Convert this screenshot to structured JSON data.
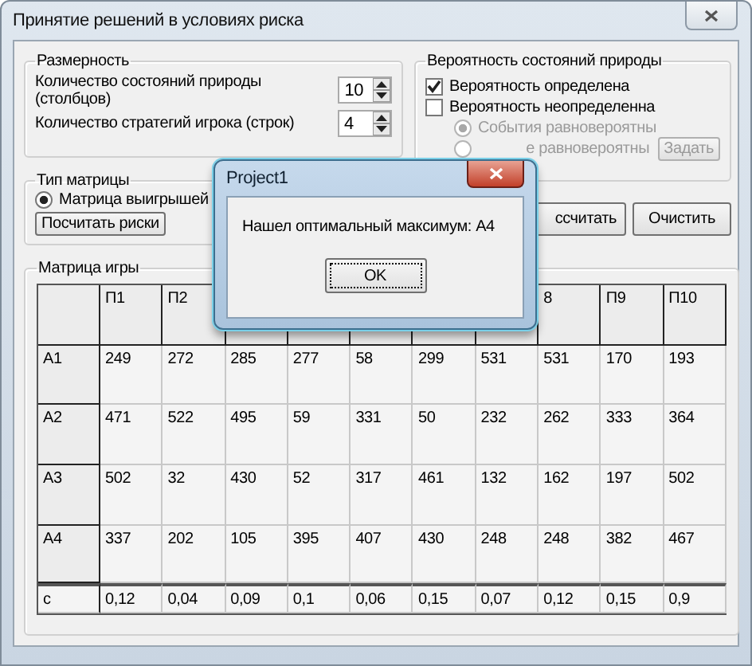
{
  "window": {
    "title": "Принятие решений в условиях риска"
  },
  "dimension_group": {
    "title": "Размерность",
    "fields": [
      {
        "label": "Количество состояний природы (столбцов)",
        "value": "10"
      },
      {
        "label": "Количество стратегий игрока (строк)",
        "value": "4"
      }
    ]
  },
  "probability_group": {
    "title": "Вероятность состояний природы",
    "options": [
      {
        "kind": "checkbox",
        "label": "Вероятность определена",
        "checked": true,
        "disabled": false
      },
      {
        "kind": "checkbox",
        "label": "Вероятность неопределенна",
        "checked": false,
        "disabled": false
      },
      {
        "kind": "radio",
        "label": "События равновероятны",
        "selected": true,
        "disabled": true
      },
      {
        "kind": "radio",
        "label": "е равновероятны",
        "selected": false,
        "disabled": true,
        "button": {
          "label": "Задать",
          "disabled": true
        }
      }
    ]
  },
  "matrix_type_group": {
    "title": "Тип матрицы",
    "options": [
      {
        "label": "Матрица выигрышей",
        "selected": true
      }
    ],
    "button": "Посчитать риски"
  },
  "actions": [
    "ссчитать",
    "Очистить"
  ],
  "game_matrix": {
    "title": "Матрица игры",
    "columns": [
      {
        "label": "П1"
      },
      {
        "label": "П2"
      },
      {},
      {},
      {},
      {},
      {},
      {
        "label": "8"
      },
      {
        "label": "П9"
      },
      {
        "label": "П10"
      }
    ],
    "rows": [
      {
        "label": "А1",
        "cells": [
          "249",
          "272",
          "285",
          "277",
          "58",
          "299",
          "531",
          "531",
          "170",
          "193"
        ]
      },
      {
        "label": "А2",
        "cells": [
          "471",
          "522",
          "495",
          "59",
          "331",
          "50",
          "232",
          "262",
          "333",
          "364"
        ]
      },
      {
        "label": "А3",
        "cells": [
          "502",
          "32",
          "430",
          "52",
          "317",
          "461",
          "132",
          "162",
          "197",
          "502"
        ]
      },
      {
        "label": "А4",
        "cells": [
          "337",
          "202",
          "105",
          "395",
          "407",
          "430",
          "248",
          "248",
          "382",
          "467"
        ]
      }
    ],
    "probability_row": {
      "label": "c",
      "cells": [
        "0,12",
        "0,04",
        "0,09",
        "0,1",
        "0,06",
        "0,15",
        "0,07",
        "0,12",
        "0,15",
        "0,9"
      ]
    }
  },
  "dialog": {
    "title": "Project1",
    "message": "Нашел оптимальный максимум: А4",
    "button": "OK"
  }
}
